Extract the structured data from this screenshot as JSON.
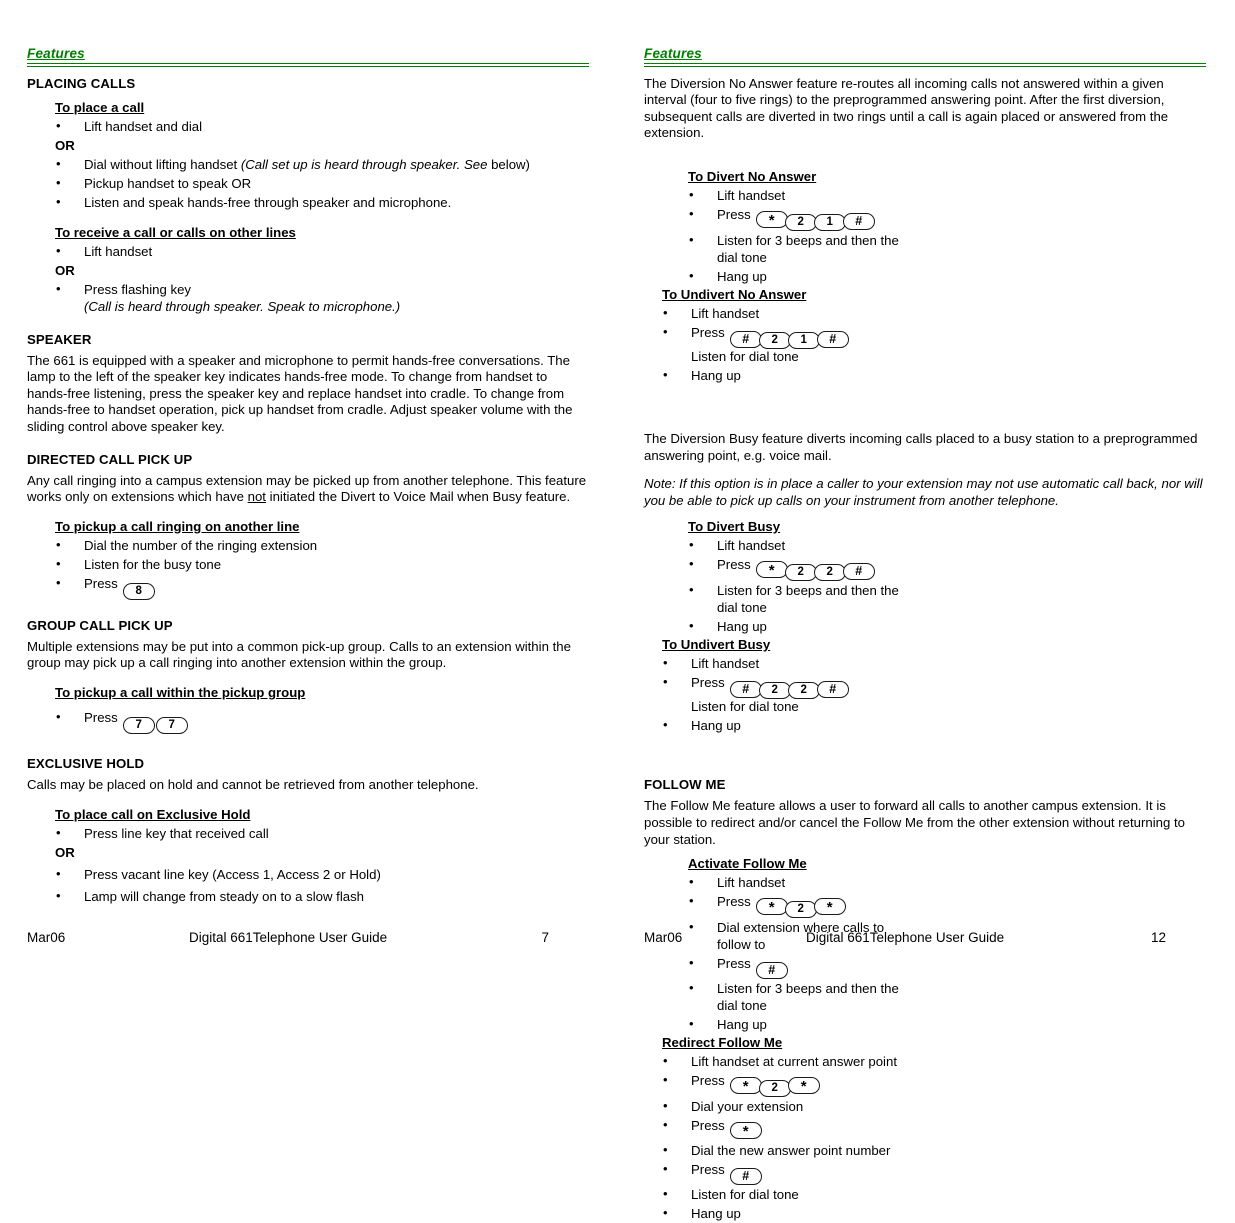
{
  "document": {
    "running_header": "Features",
    "accent_color": "#008000"
  },
  "left_page": {
    "footer": {
      "date": "Mar06",
      "title": "Digital 661Telephone User Guide",
      "page": "7"
    },
    "sections": [
      {
        "heading": "PLACING CALLS",
        "sub_a_title": "To place a call",
        "sub_a_step1": "Lift handset and dial",
        "or": "OR",
        "sub_a_step2_plain": "Dial without lifting handset ",
        "sub_a_step2_italic": "(Call set up is heard through speaker. See",
        "sub_a_step2_tail": " below)",
        "sub_a_step3": "Pickup handset to speak OR",
        "sub_a_step4": "Listen and speak hands-free through speaker and microphone.",
        "sub_b_title": "To receive a call or calls on other lines",
        "sub_b_step1": "Lift handset",
        "sub_b_or": "OR",
        "sub_b_step2": "Press flashing key",
        "sub_b_step2_cont": "(Call is heard through speaker.  Speak to microphone.)"
      },
      {
        "heading": "SPEAKER",
        "body": "The 661 is equipped with a speaker and microphone to permit hands-free conversations.  The lamp to the left of the speaker key indicates hands-free mode.  To change from handset to hands-free listening, press the speaker key and replace handset into cradle.  To change from hands-free to handset operation, pick up handset from cradle.  Adjust speaker volume with the sliding control above speaker key."
      },
      {
        "heading": "DIRECTED CALL PICK UP",
        "body_part1": "Any call ringing into a campus extension may be picked up from another telephone. This feature works only on extensions which have ",
        "body_underlined": "not",
        "body_part2": " initiated the Divert to Voice Mail when Busy feature.",
        "sub_title": "To pickup a call ringing on another line",
        "step1": "Dial the number of the ringing extension",
        "step2": "Listen for the busy tone",
        "step3_label": "Press",
        "step3_keys": [
          "8"
        ]
      },
      {
        "heading": "GROUP CALL PICK UP",
        "body": "Multiple extensions may be put into a common pick-up group.  Calls to an extension within the group may pick up a call ringing into another extension within the group.",
        "sub_title": "To pickup a call within the pickup group",
        "step1_label": "Press",
        "step1_keys": [
          "7",
          "7"
        ]
      },
      {
        "heading": "EXCLUSIVE HOLD",
        "body": "Calls may be placed on hold and cannot be retrieved from another telephone.",
        "sub_title": "To place call on Exclusive Hold",
        "step1": "Press line key that received call",
        "or": "OR",
        "step2": "Press vacant line key  (Access 1, Access 2 or Hold)",
        "step3": "Lamp will change from steady on to a slow flash"
      }
    ]
  },
  "right_page": {
    "footer": {
      "date": "Mar06",
      "title": "Digital 661Telephone User Guide",
      "page": "12"
    },
    "diversion_no_answer": {
      "intro": "The Diversion No Answer feature re-routes all incoming calls not answered within a given interval (four to five rings) to the preprogrammed answering point.  After the first diversion, subsequent calls are diverted in two rings until a call is again placed or answered from the extension.",
      "divert": {
        "title": "To Divert No Answer",
        "step1": "Lift handset",
        "step2_label": "Press",
        "step2_keys": [
          "*",
          "2",
          "1",
          "#"
        ],
        "step3": "Listen for 3 beeps and then the",
        "step3_cont": "dial tone",
        "step4": "Hang up"
      },
      "undivert": {
        "title": "To Undivert No Answer",
        "step1": "Lift handset",
        "step2_label": "Press",
        "step2_keys": [
          "#",
          "2",
          "1",
          "#"
        ],
        "step3_cont": "Listen for dial tone",
        "step4": "Hang up"
      }
    },
    "diversion_busy": {
      "intro": "The Diversion Busy feature diverts incoming calls placed to a busy station to a preprogrammed answering point, e.g. voice mail.",
      "note": "Note: If this option is in place a caller to your extension may not use automatic call back, nor will you be able to pick up calls on your instrument from another telephone.",
      "divert": {
        "title": "To Divert Busy",
        "step1": "Lift handset",
        "step2_label": "Press",
        "step2_keys": [
          "*",
          "2",
          "2",
          "#"
        ],
        "step3": "Listen for 3 beeps and then the",
        "step3_cont": "dial tone",
        "step4": "Hang up"
      },
      "undivert": {
        "title": "To Undivert Busy",
        "step1": "Lift handset",
        "step2_label": "Press",
        "step2_keys": [
          "#",
          "2",
          "2",
          "#"
        ],
        "step3_cont": "Listen for dial tone",
        "step4": "Hang up"
      }
    },
    "follow_me": {
      "heading": "FOLLOW ME",
      "intro": "The Follow Me feature allows a user to forward all calls to another campus extension.  It is possible to redirect and/or cancel the Follow Me from the other extension without returning to your station.",
      "activate": {
        "title": "Activate Follow Me",
        "step1": "Lift handset",
        "step2_label": "Press",
        "step2_keys": [
          "*",
          "2",
          "*"
        ],
        "step3": "Dial extension where calls to",
        "step3_cont": "follow to",
        "step4_label": "Press",
        "step4_keys": [
          "#"
        ],
        "step5": "Listen for 3 beeps and then the",
        "step5_cont": "dial tone",
        "step6": "Hang up"
      },
      "redirect": {
        "title": "Redirect Follow Me",
        "step1": "Lift handset at current answer point",
        "step2_label": "Press",
        "step2_keys": [
          "*",
          "2",
          "*"
        ],
        "step3": "Dial your extension",
        "step4_label": "Press",
        "step4_keys": [
          "*"
        ],
        "step5": "Dial the new answer point number",
        "step6_label": "Press",
        "step6_keys": [
          "#"
        ],
        "step7": "Listen for dial tone",
        "step8": "Hang up"
      }
    }
  }
}
